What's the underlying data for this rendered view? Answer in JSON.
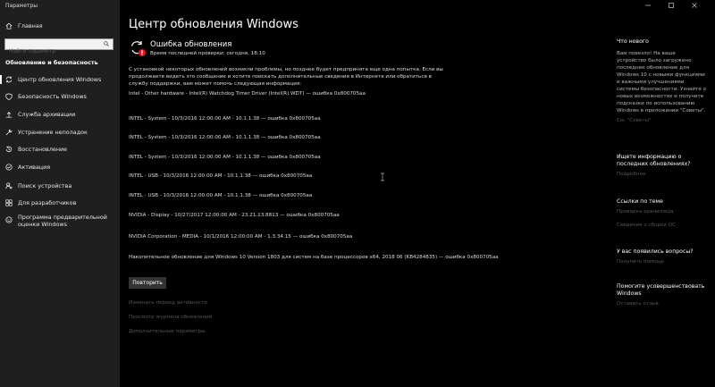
{
  "window": {
    "title": "Параметры",
    "icons": [
      "minimize-icon",
      "maximize-icon",
      "close-icon"
    ]
  },
  "sidebar": {
    "home_label": "Главная",
    "search_placeholder": "Найти параметр",
    "section_title": "Обновление и безопасность",
    "items": [
      {
        "label": "Центр обновления Windows",
        "icon": "sync-icon",
        "active": true
      },
      {
        "label": "Безопасность Windows",
        "icon": "shield-icon"
      },
      {
        "label": "Служба архивации",
        "icon": "backup-arrow-icon"
      },
      {
        "label": "Устранение неполадок",
        "icon": "wrench-icon"
      },
      {
        "label": "Восстановление",
        "icon": "history-icon"
      },
      {
        "label": "Активация",
        "icon": "check-circle-icon"
      },
      {
        "label": "Поиск устройства",
        "icon": "person-location-icon"
      },
      {
        "label": "Для разработчиков",
        "icon": "developer-grid-icon"
      },
      {
        "label": "Программа предварительной оценки Windows",
        "icon": "insider-smiley-icon"
      }
    ]
  },
  "main": {
    "title": "Центр обновления Windows",
    "status_title": "Ошибка обновления",
    "status_sub": "Время последней проверки: сегодня, 18:10",
    "paragraph": "С установкой некоторых обновлений возникли проблемы, но позднее будет предпринята еще одна попытка. Если вы продолжаете видеть это сообщение и хотите поискать дополнительные сведения в Интернете или обратиться в службу поддержки, вам может помочь следующая информация:",
    "errors": [
      "Intel - Other hardware - Intel(R) Watchdog Timer Driver (Intel(R) WDT) — ошибка 0x800705aa",
      "INTEL - System - 10/3/2016 12:00:00 AM - 10.1.1.38 — ошибка 0x800705aa",
      "INTEL - System - 10/3/2016 12:00:00 AM - 10.1.1.38 — ошибка 0x800705aa",
      "INTEL - System - 10/3/2016 12:00:00 AM - 10.1.1.38 — ошибка 0x800705aa",
      "INTEL - USB - 10/3/2016 12:00:00 AM - 10.1.1.38 — ошибка 0x800705aa",
      "INTEL - USB - 10/3/2016 12:00:00 AM - 10.1.1.38 — ошибка 0x800705aa",
      "NVIDIA - Display - 10/27/2017 12:00:00 AM - 23.21.13.8813 — ошибка 0x800705aa",
      "NVIDIA Corporation - MEDIA - 10/1/2016 12:00:00 AM - 1.3.34.15 — ошибка 0x800705aa",
      "Накопительное обновление для Windows 10 Version 1803 для систем на базе процессоров x64, 2018 06 (KB4284835) — ошибка 0x800705aa"
    ],
    "retry_label": "Повторить",
    "links": [
      "Изменить период активности",
      "Просмотр журнала обновлений",
      "Дополнительные параметры"
    ]
  },
  "right": {
    "whats_new_title": "Что нового",
    "whats_new_text": "Вам повезло! На ваше устройство было загружено последнее обновление для Windows 10 с новыми функциями и важными улучшениями системы безопасности. Узнайте о новых возможностях и получите подсказки по использованию Windows в приложении \"Советы\".",
    "whats_new_link": "См. \"Советы\"",
    "info_title": "Ищете информацию о последних обновлениях?",
    "info_link": "Подробнее",
    "links_title": "Ссылки по теме",
    "links": [
      "Проверка хранилища",
      "Сведения о сборке ОС"
    ],
    "questions_title": "У вас появились вопросы?",
    "questions_link": "Получить помощь",
    "feedback_title": "Помогите усовершенствовать Windows",
    "feedback_link": "Оставить отзыв"
  },
  "colors": {
    "background": "#000000",
    "sidebar": "#1f1f1f",
    "error": "#e81123"
  }
}
